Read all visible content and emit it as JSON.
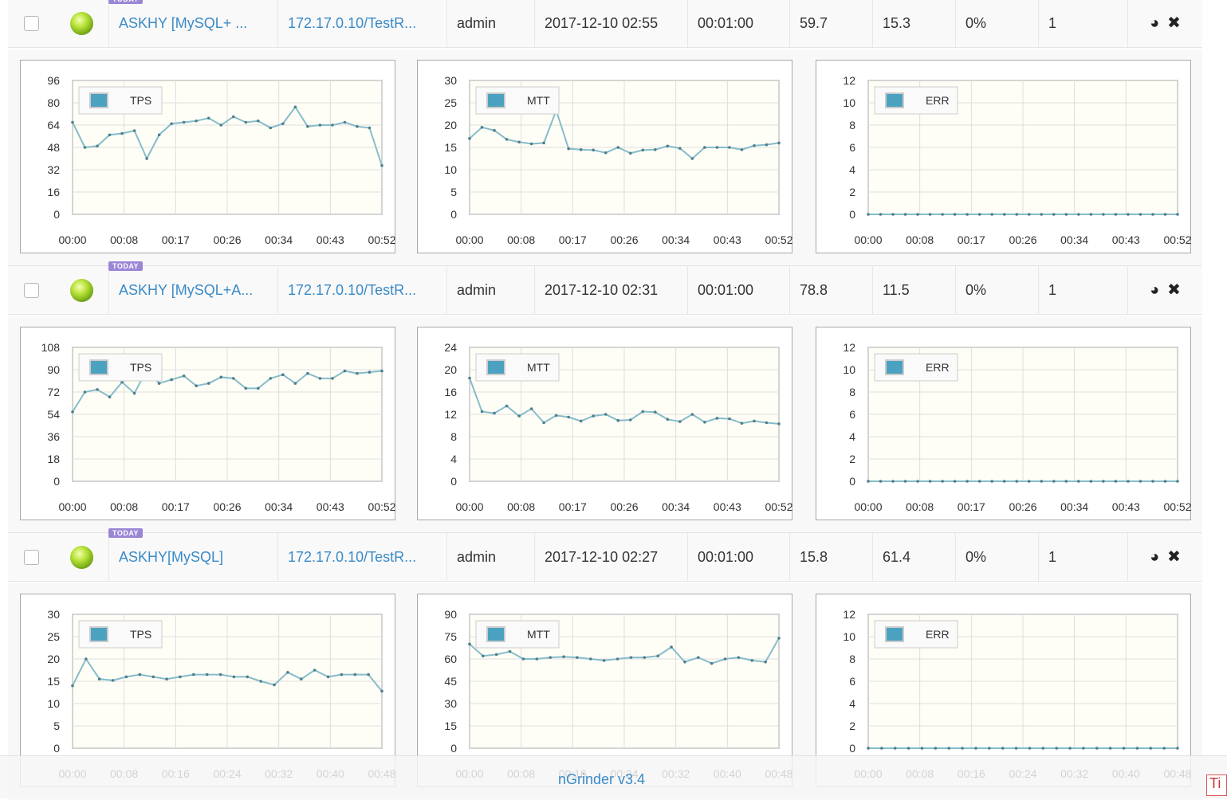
{
  "tests": [
    {
      "badge": "TODAY",
      "name": "ASKHY [MySQL+ ...",
      "target": "172.17.0.10/TestR...",
      "owner": "admin",
      "start_time": "2017-12-10 02:55",
      "duration": "00:01:00",
      "tps": "59.7",
      "mtt": "15.3",
      "error_rate": "0%",
      "vusers": "1",
      "charts": [
        {
          "name": "TPS",
          "type": "line",
          "legend": "TPS",
          "yticks": [
            "0",
            "16",
            "32",
            "48",
            "64",
            "80",
            "96"
          ],
          "ymax": 96,
          "xticks": [
            "00:00",
            "00:08",
            "00:17",
            "00:26",
            "00:34",
            "00:43",
            "00:52"
          ],
          "values": [
            66,
            48,
            49,
            57,
            58,
            60,
            40,
            57,
            65,
            66,
            67,
            69,
            64,
            70,
            66,
            67,
            62,
            65,
            77,
            63,
            64,
            64,
            66,
            63,
            62,
            35
          ]
        },
        {
          "name": "MTT",
          "type": "line",
          "legend": "MTT",
          "yticks": [
            "0",
            "5",
            "10",
            "15",
            "20",
            "25",
            "30"
          ],
          "ymax": 30,
          "xticks": [
            "00:00",
            "00:08",
            "00:17",
            "00:26",
            "00:34",
            "00:43",
            "00:52"
          ],
          "values": [
            17,
            19.5,
            18.8,
            16.8,
            16.2,
            15.8,
            16,
            23.3,
            14.7,
            14.5,
            14.4,
            13.8,
            15,
            13.7,
            14.4,
            14.5,
            15.3,
            14.8,
            12.5,
            15,
            15,
            15,
            14.5,
            15.4,
            15.6,
            16
          ]
        },
        {
          "name": "ERR",
          "type": "line",
          "legend": "ERR",
          "yticks": [
            "0",
            "2",
            "4",
            "6",
            "8",
            "10",
            "12"
          ],
          "ymax": 12,
          "xticks": [
            "00:00",
            "00:08",
            "00:17",
            "00:26",
            "00:34",
            "00:43",
            "00:52"
          ],
          "values": [
            0,
            0,
            0,
            0,
            0,
            0,
            0,
            0,
            0,
            0,
            0,
            0,
            0,
            0,
            0,
            0,
            0,
            0,
            0,
            0,
            0,
            0,
            0,
            0,
            0,
            0
          ]
        }
      ]
    },
    {
      "badge": "TODAY",
      "name": "ASKHY [MySQL+A...",
      "target": "172.17.0.10/TestR...",
      "owner": "admin",
      "start_time": "2017-12-10 02:31",
      "duration": "00:01:00",
      "tps": "78.8",
      "mtt": "11.5",
      "error_rate": "0%",
      "vusers": "1",
      "charts": [
        {
          "name": "TPS",
          "type": "line",
          "legend": "TPS",
          "yticks": [
            "0",
            "18",
            "36",
            "54",
            "72",
            "90",
            "108"
          ],
          "ymax": 108,
          "xticks": [
            "00:00",
            "00:08",
            "00:17",
            "00:26",
            "00:34",
            "00:43",
            "00:52"
          ],
          "values": [
            56,
            72,
            74,
            68,
            80,
            71,
            90,
            79,
            82,
            85,
            77,
            79,
            84,
            83,
            75,
            75,
            83,
            86,
            79,
            87,
            83,
            83,
            89,
            87,
            88,
            89
          ]
        },
        {
          "name": "MTT",
          "type": "line",
          "legend": "MTT",
          "yticks": [
            "0",
            "4",
            "8",
            "12",
            "16",
            "20",
            "24"
          ],
          "ymax": 24,
          "xticks": [
            "00:00",
            "00:08",
            "00:17",
            "00:26",
            "00:34",
            "00:43",
            "00:52"
          ],
          "values": [
            18.5,
            12.5,
            12.2,
            13.5,
            11.7,
            13,
            10.5,
            11.8,
            11.5,
            10.8,
            11.7,
            12,
            10.9,
            11,
            12.5,
            12.4,
            11.1,
            10.7,
            12,
            10.6,
            11.3,
            11.2,
            10.4,
            10.8,
            10.5,
            10.3
          ]
        },
        {
          "name": "ERR",
          "type": "line",
          "legend": "ERR",
          "yticks": [
            "0",
            "2",
            "4",
            "6",
            "8",
            "10",
            "12"
          ],
          "ymax": 12,
          "xticks": [
            "00:00",
            "00:08",
            "00:17",
            "00:26",
            "00:34",
            "00:43",
            "00:52"
          ],
          "values": [
            0,
            0,
            0,
            0,
            0,
            0,
            0,
            0,
            0,
            0,
            0,
            0,
            0,
            0,
            0,
            0,
            0,
            0,
            0,
            0,
            0,
            0,
            0,
            0,
            0,
            0
          ]
        }
      ]
    },
    {
      "badge": "TODAY",
      "name": "ASKHY[MySQL]",
      "target": "172.17.0.10/TestR...",
      "owner": "admin",
      "start_time": "2017-12-10 02:27",
      "duration": "00:01:00",
      "tps": "15.8",
      "mtt": "61.4",
      "error_rate": "0%",
      "vusers": "1",
      "charts": [
        {
          "name": "TPS",
          "type": "line",
          "legend": "TPS",
          "yticks": [
            "0",
            "5",
            "10",
            "15",
            "20",
            "25",
            "30"
          ],
          "ymax": 30,
          "xticks": [
            "00:00",
            "00:08",
            "00:16",
            "00:24",
            "00:32",
            "00:40",
            "00:48"
          ],
          "values": [
            14,
            20,
            15.5,
            15.2,
            16,
            16.5,
            16,
            15.5,
            16,
            16.5,
            16.5,
            16.5,
            16,
            16,
            15,
            14.2,
            17,
            15.5,
            17.5,
            16,
            16.5,
            16.5,
            16.5,
            12.8
          ]
        },
        {
          "name": "MTT",
          "type": "line",
          "legend": "MTT",
          "yticks": [
            "0",
            "15",
            "30",
            "45",
            "60",
            "75",
            "90"
          ],
          "ymax": 90,
          "xticks": [
            "00:00",
            "00:08",
            "00:16",
            "00:24",
            "00:32",
            "00:40",
            "00:48"
          ],
          "values": [
            70,
            62,
            63,
            65,
            60,
            60,
            61,
            61.5,
            61,
            60,
            59,
            60,
            61,
            61,
            62,
            68,
            58,
            61,
            57,
            60,
            61,
            59,
            58,
            74
          ]
        },
        {
          "name": "ERR",
          "type": "line",
          "legend": "ERR",
          "yticks": [
            "0",
            "2",
            "4",
            "6",
            "8",
            "10",
            "12"
          ],
          "ymax": 12,
          "xticks": [
            "00:00",
            "00:08",
            "00:16",
            "00:24",
            "00:32",
            "00:40",
            "00:48"
          ],
          "values": [
            0,
            0,
            0,
            0,
            0,
            0,
            0,
            0,
            0,
            0,
            0,
            0,
            0,
            0,
            0,
            0,
            0,
            0,
            0,
            0,
            0,
            0,
            0,
            0
          ]
        }
      ]
    }
  ],
  "footer": {
    "version_link": "nGrinder v3.4",
    "corner_label": "Ti"
  },
  "colors": {
    "link": "#3a8ac7",
    "line": "#86bccb",
    "legend_swatch": "#4ba2c0",
    "plot_bg": "#fffef6"
  }
}
